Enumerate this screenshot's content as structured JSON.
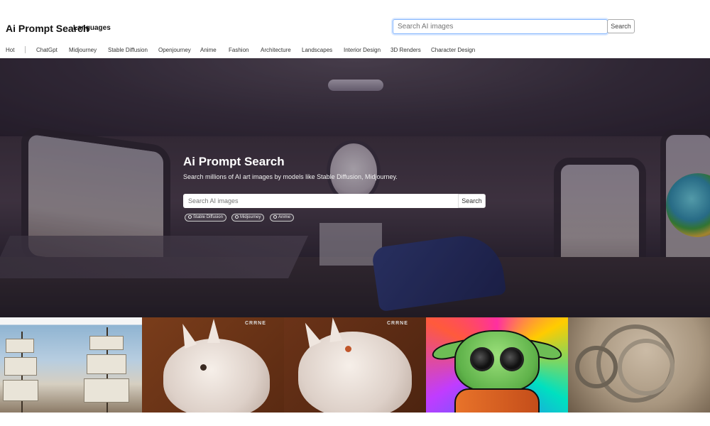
{
  "header": {
    "brand": "Ai Prompt Search",
    "languages_label": "Languages",
    "search_placeholder": "Search AI images",
    "search_button": "Search"
  },
  "nav": {
    "items": [
      "Hot",
      "ChatGpt",
      "Midjourney",
      "Stable Diffusion",
      "Openjourney",
      "Anime",
      "Fashion",
      "Architecture",
      "Landscapes",
      "Interior Design",
      "3D Renders",
      "Character Design"
    ]
  },
  "hero": {
    "title": "Ai Prompt Search",
    "subtitle": "Search millions of AI art images by models like Stable Diffusion, Midjourney.",
    "search_placeholder": "Search AI images",
    "search_button": "Search",
    "chips": [
      "Stable Diffusion",
      "Midjourney",
      "Anime"
    ]
  },
  "gallery": {
    "watermark": "CRRNE"
  },
  "colors": {
    "focus_border": "#86b7fe",
    "hero_overlay": "#2b2430"
  }
}
